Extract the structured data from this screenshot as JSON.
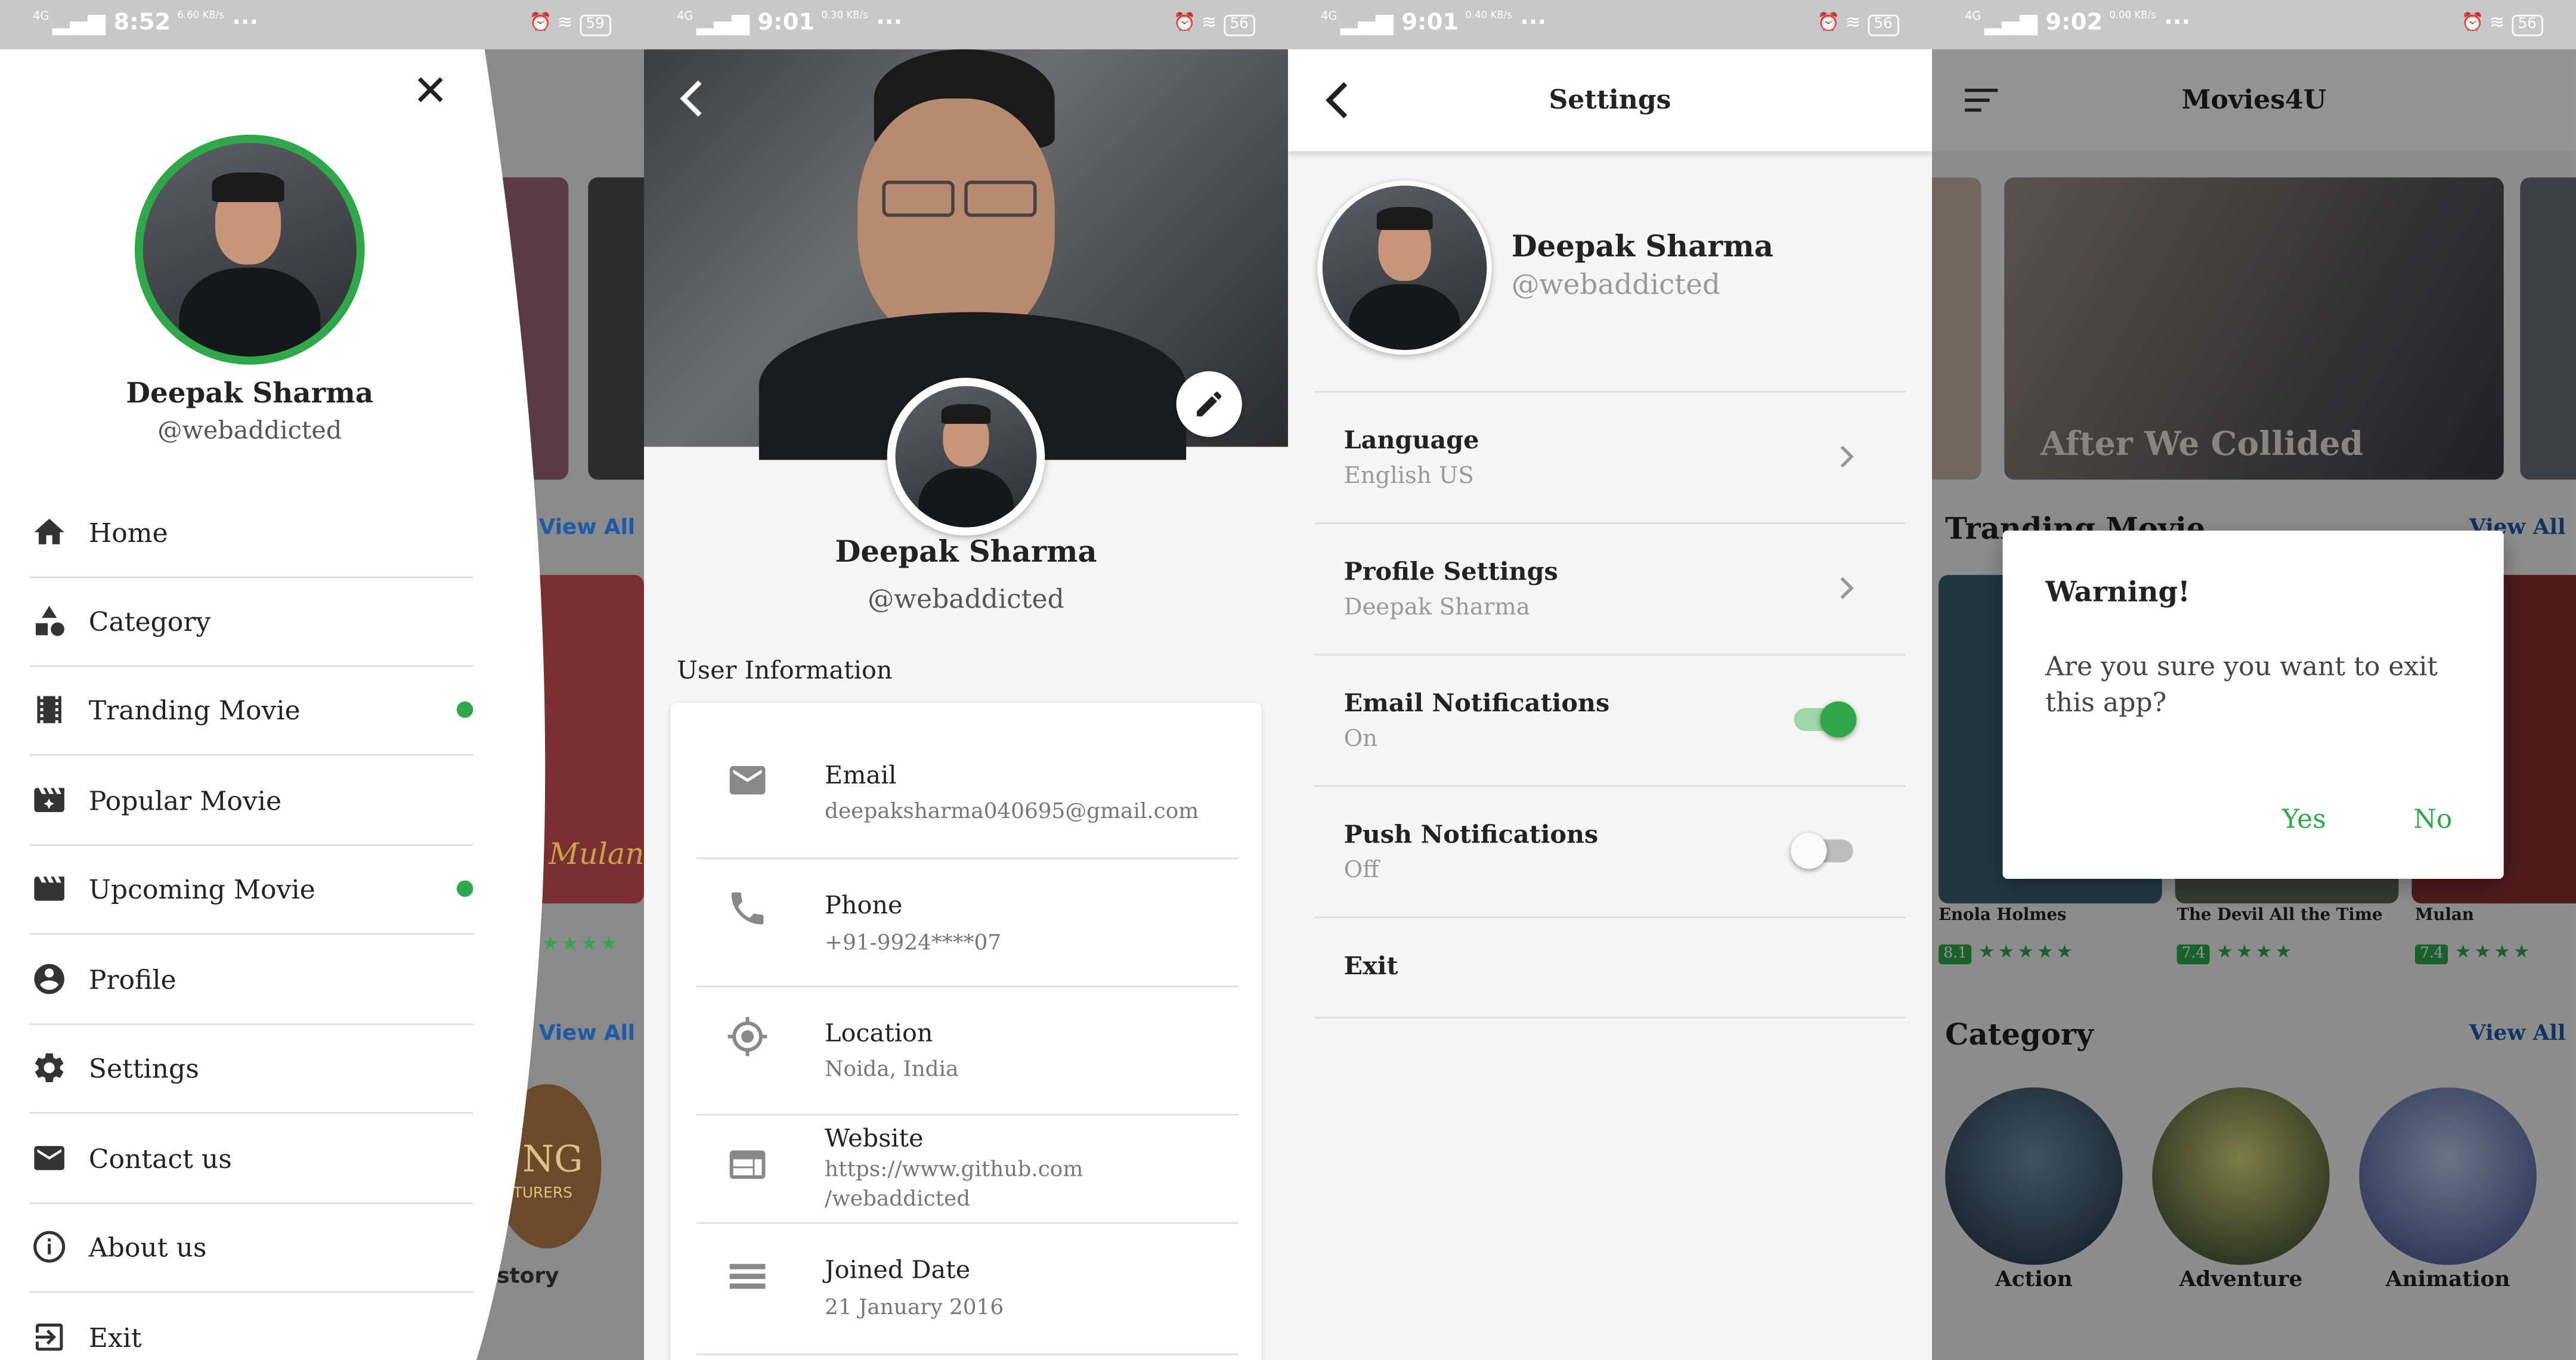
{
  "colors": {
    "accent": "#2ea84a",
    "text": "#222222",
    "muted": "#777777",
    "link": "#1e5aa8"
  },
  "status": [
    {
      "net": "4G",
      "time": "8:52",
      "speed": "6.60 KB/s",
      "battery": "59"
    },
    {
      "net": "4G",
      "time": "9:01",
      "speed": "0.30 KB/s",
      "battery": "56"
    },
    {
      "net": "4G",
      "time": "9:01",
      "speed": "0.40 KB/s",
      "battery": "56"
    },
    {
      "net": "4G",
      "time": "9:02",
      "speed": "0.00 KB/s",
      "battery": "56"
    }
  ],
  "drawer": {
    "name": "Deepak Sharma",
    "handle": "@webaddicted",
    "items": [
      {
        "label": "Home",
        "icon": "home-icon"
      },
      {
        "label": "Category",
        "icon": "shapes-icon"
      },
      {
        "label": "Tranding Movie",
        "icon": "film-strip-icon",
        "dot": true
      },
      {
        "label": "Popular Movie",
        "icon": "movie-star-icon"
      },
      {
        "label": "Upcoming Movie",
        "icon": "clapper-icon",
        "dot": true
      },
      {
        "label": "Profile",
        "icon": "account-circle-icon"
      },
      {
        "label": "Settings",
        "icon": "gear-icon"
      },
      {
        "label": "Contact us",
        "icon": "mail-icon"
      },
      {
        "label": "About us",
        "icon": "info-icon"
      },
      {
        "label": "Exit",
        "icon": "exit-icon"
      }
    ],
    "bg_view_all": "View All",
    "bg_history": "istory",
    "bg_mulan": "Mulan",
    "bg_ng": "NG",
    "bg_enturers": "ENTURERS"
  },
  "profile": {
    "name": "Deepak Sharma",
    "handle": "@webaddicted",
    "section_title": "User Information",
    "rows": [
      {
        "key": "Email",
        "value": "deepaksharma040695@gmail.com"
      },
      {
        "key": "Phone",
        "value": "+91-9924****07"
      },
      {
        "key": "Location",
        "value": "Noida, India"
      },
      {
        "key": "Website",
        "value": "https://www.github.com",
        "value2": "/webaddicted"
      },
      {
        "key": "Joined Date",
        "value": "21 January 2016"
      }
    ]
  },
  "settings": {
    "title": "Settings",
    "name": "Deepak Sharma",
    "handle": "@webaddicted",
    "rows": [
      {
        "title": "Language",
        "sub": "English US"
      },
      {
        "title": "Profile Settings",
        "sub": "Deepak Sharma"
      },
      {
        "title": "Email Notifications",
        "sub": "On",
        "toggle": true
      },
      {
        "title": "Push Notifications",
        "sub": "Off",
        "toggle": false
      },
      {
        "title": "Exit"
      }
    ]
  },
  "home": {
    "title": "Movies4U",
    "banner": "After We Collided",
    "section1": "Tranding Movie",
    "view_all": "View All",
    "movies": [
      {
        "title": "Enola Holmes",
        "rating": "8.1"
      },
      {
        "title": "The Devil All the Time",
        "rating": "7.4"
      },
      {
        "title": "Mulan",
        "rating": "7.4"
      }
    ],
    "section2": "Category",
    "categories": [
      "Action",
      "Adventure",
      "Animation"
    ],
    "dialog": {
      "title": "Warning!",
      "message": "Are you sure you want to exit this app?",
      "yes": "Yes",
      "no": "No"
    }
  }
}
